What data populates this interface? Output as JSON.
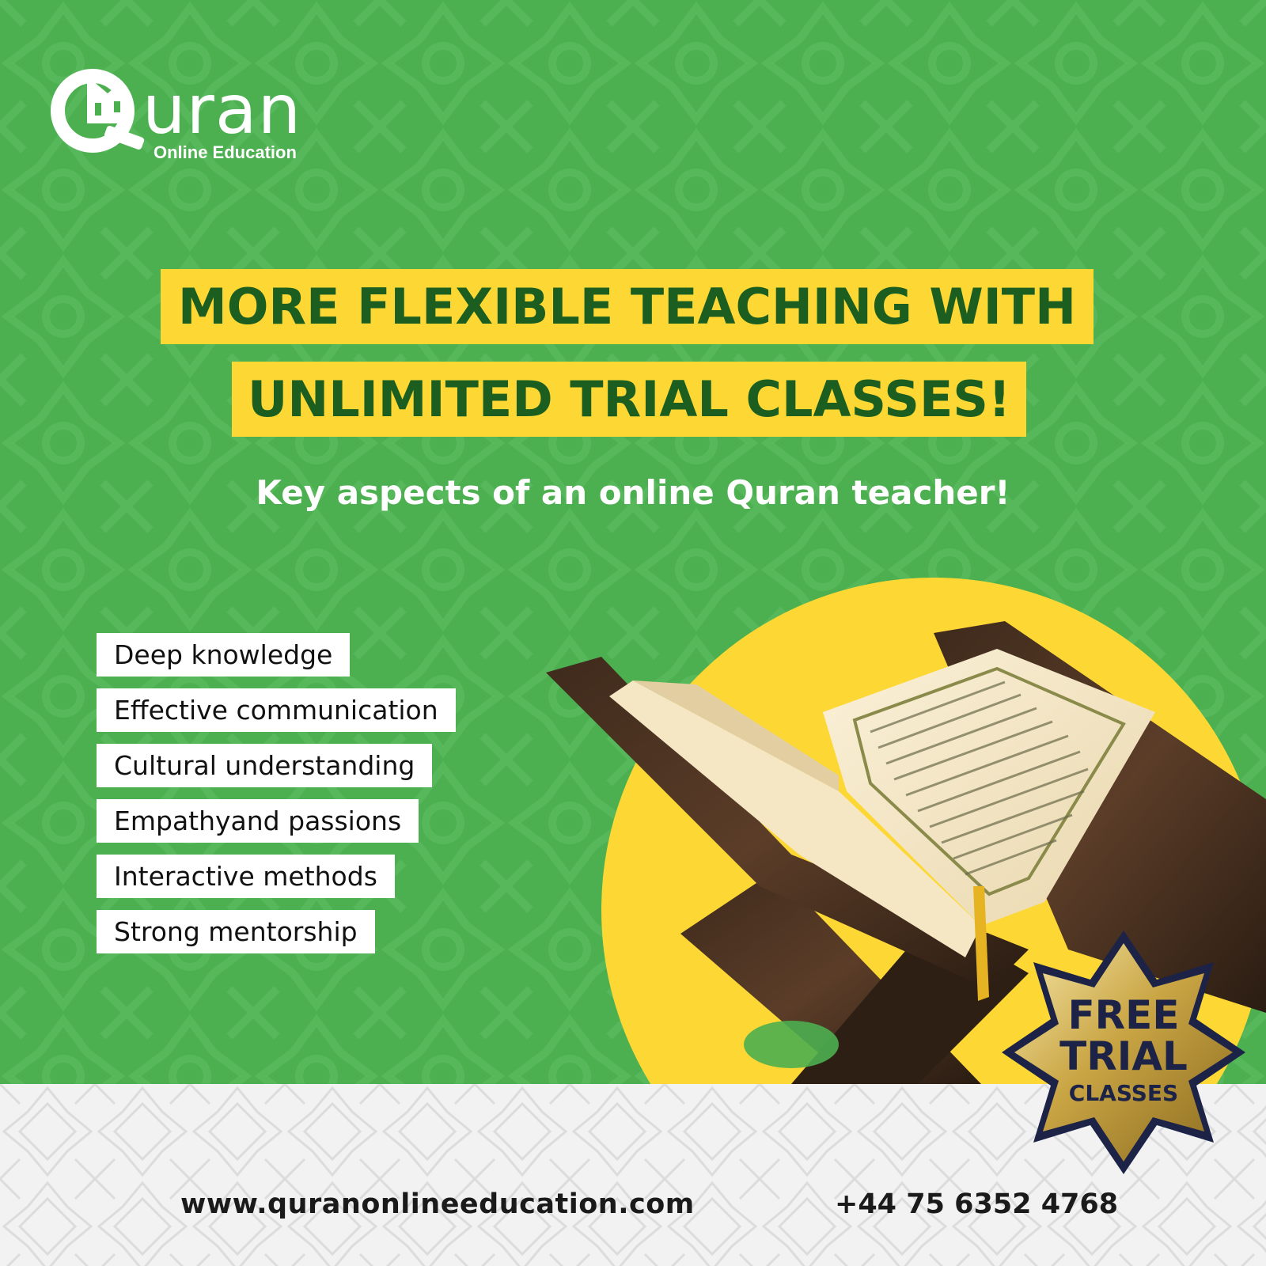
{
  "brand": {
    "name": "uran",
    "tagline": "Online Education"
  },
  "headline": {
    "line1": "MORE FLEXIBLE TEACHING WITH",
    "line2": "UNLIMITED TRIAL CLASSES!"
  },
  "subtitle": "Key aspects of an online Quran teacher!",
  "aspects": [
    "Deep knowledge",
    "Effective communication",
    "Cultural understanding",
    "Empathyand passions",
    "Interactive methods",
    "Strong mentorship"
  ],
  "badge": {
    "line1": "FREE",
    "line2": "TRIAL",
    "line3": "CLASSES"
  },
  "contact": {
    "website": "www.quranonlineeducation.com",
    "phone": "+44 75 6352 4768"
  },
  "colors": {
    "background_green": "#4caf50",
    "highlight_yellow": "#fdd835",
    "headline_text": "#1b5e20",
    "badge_text": "#1c2347",
    "band_gray": "#f2f2f2"
  },
  "icons": [
    "quran-logo-icon",
    "mosque-dome-icon",
    "quran-stand-illustration",
    "star-badge-icon"
  ]
}
